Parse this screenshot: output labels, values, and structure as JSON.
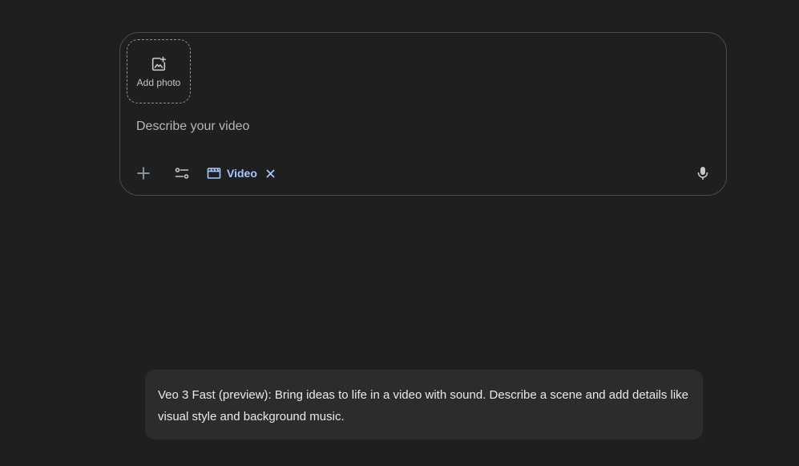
{
  "composer": {
    "add_photo_label": "Add photo",
    "prompt_placeholder": "Describe your video",
    "prompt_value": "",
    "toolbar": {
      "add_icon": "plus-icon",
      "tools_icon": "tune-icon",
      "chip_label": "Video",
      "chip_icon": "movie-icon",
      "chip_close_icon": "close-icon",
      "mic_icon": "mic-icon"
    }
  },
  "tooltip": {
    "text": "Veo 3 Fast (preview): Bring ideas to life in a video with sound. Describe a scene and add details like visual style and background music."
  },
  "colors": {
    "background": "#1e1f20",
    "border": "#4a4c50",
    "accent": "#a8c7fa",
    "tooltip_bg": "#2b2c2e"
  }
}
